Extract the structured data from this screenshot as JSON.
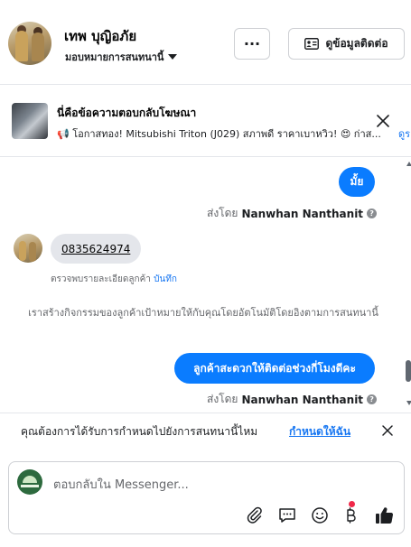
{
  "header": {
    "name": "เทพ บุญิอภัย",
    "assign_label": "มอบหมายการสนทนานี้",
    "more_label": "···",
    "contact_label": "ดูข้อมูลติดต่อ"
  },
  "ad": {
    "title": "นี่คือข้อความตอบกลับโฆษณา",
    "snippet": "📢 โอกาสทอง! Mitsubishi Triton (J029) สภาพดี ราคาเบาหวิว! 😍 ก่าส...",
    "more": "ดูร"
  },
  "messages": {
    "out1": "มั้ย",
    "sent_prefix": "ส่งโดย",
    "sender": "Nanwhan Nanthanit",
    "in1": "0835624974",
    "note_prefix": "ตรวจพบรายละเอียดลูกค้า",
    "note_link": "บันทึก",
    "system": "เราสร้างกิจกรรมของลูกค้าเป้าหมายให้กับคุณโดยอัตโนมัติโดยอิงตามการสนทนานี้",
    "out2": "ลูกค้าสะดวกให้ติดต่อช่วงกี่โมงดีคะ"
  },
  "reminder": {
    "text": "คุณต้องการได้รับการกำหนดไปยังการสนทนานี้ไหม",
    "link": "กำหนดให้ฉัน"
  },
  "composer": {
    "placeholder": "ตอบกลับใน Messenger...",
    "tools": [
      "paperclip-icon",
      "saved-reply-icon",
      "emoji-icon",
      "payment-icon",
      "like-icon"
    ]
  },
  "colors": {
    "accent": "#0a7cff",
    "link": "#1877f2",
    "alert": "#f02849"
  }
}
